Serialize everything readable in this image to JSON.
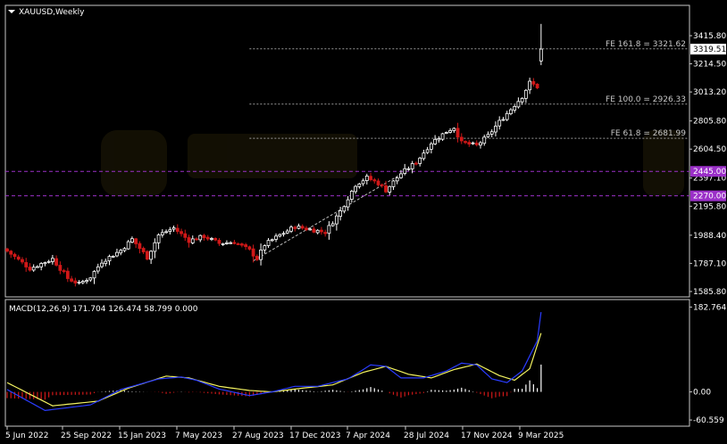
{
  "header": {
    "symbol_label": "XAUUSD,Weekly"
  },
  "indicator": {
    "label": "MACD(12,26,9) 171.704 126.474 58.799 0.000"
  },
  "colors": {
    "background": "#000000",
    "grid": "#3a3a3a",
    "frame": "#c8c8c8",
    "bull_candle": "#ffffff",
    "bear_candle": "#d01818",
    "fib_line": "#9a9a9a",
    "level_line": "#9b30c8",
    "level_badge": "#9b30c8",
    "current_price_badge": "#ffffff",
    "macd_line": "#2a3cff",
    "signal_line": "#f2f260",
    "hist_positive": "#ffffff",
    "hist_negative": "#d01818"
  },
  "chart_data": [
    {
      "type": "candlestick",
      "title": "XAUUSD,Weekly",
      "x_tick_labels": [
        "5 Jun 2022",
        "25 Sep 2022",
        "15 Jan 2023",
        "7 May 2023",
        "27 Aug 2023",
        "17 Dec 2023",
        "7 Apr 2024",
        "28 Jul 2024",
        "17 Nov 2024",
        "9 Mar 2025"
      ],
      "y_tick_labels": [
        "3415.80",
        "3214.50",
        "3013.20",
        "2805.80",
        "2604.50",
        "2397.10",
        "2195.80",
        "1988.40",
        "1787.10",
        "1585.80"
      ],
      "y_ticks": [
        3415.8,
        3214.5,
        3013.2,
        2805.8,
        2604.5,
        2397.1,
        2195.8,
        1988.4,
        1787.1,
        1585.8
      ],
      "ylim": [
        1560,
        3620
      ],
      "current_price": 3319.51,
      "current_price_label": "3319.51",
      "horizontal_levels": [
        {
          "value": 2445.0,
          "label": "2445.00"
        },
        {
          "value": 2270.0,
          "label": "2270.00"
        }
      ],
      "fib_levels": [
        {
          "value": 3321.62,
          "label": "FE 161.8 = 3321.62"
        },
        {
          "value": 2926.33,
          "label": "FE 100.0 = 2926.33"
        },
        {
          "value": 2681.99,
          "label": "FE 61.8 = 2681.99"
        }
      ],
      "trend_line": {
        "from_week": 65,
        "from_value": 1805,
        "to_week": 104,
        "to_value": 2425
      },
      "close_path": [
        [
          0,
          1875
        ],
        [
          6,
          1750
        ],
        [
          12,
          1820
        ],
        [
          16,
          1680
        ],
        [
          19,
          1640
        ],
        [
          22,
          1690
        ],
        [
          25,
          1800
        ],
        [
          30,
          1880
        ],
        [
          33,
          1960
        ],
        [
          37,
          1830
        ],
        [
          40,
          1990
        ],
        [
          44,
          2040
        ],
        [
          48,
          1950
        ],
        [
          52,
          1980
        ],
        [
          56,
          1930
        ],
        [
          60,
          1940
        ],
        [
          64,
          1880
        ],
        [
          66,
          1820
        ],
        [
          68,
          1920
        ],
        [
          72,
          1990
        ],
        [
          76,
          2050
        ],
        [
          80,
          2030
        ],
        [
          84,
          2010
        ],
        [
          88,
          2160
        ],
        [
          92,
          2350
        ],
        [
          95,
          2400
        ],
        [
          98,
          2360
        ],
        [
          100,
          2310
        ],
        [
          104,
          2430
        ],
        [
          108,
          2510
        ],
        [
          112,
          2650
        ],
        [
          116,
          2730
        ],
        [
          118,
          2760
        ],
        [
          120,
          2650
        ],
        [
          124,
          2630
        ],
        [
          127,
          2700
        ],
        [
          130,
          2800
        ],
        [
          134,
          2920
        ],
        [
          136,
          2980
        ],
        [
          138,
          3080
        ],
        [
          140,
          3050
        ],
        [
          141,
          3300
        ]
      ],
      "final_bar": {
        "open": 3235,
        "high": 3500,
        "low": 3205,
        "close": 3319.51
      }
    },
    {
      "type": "macd",
      "params": "MACD(12,26,9)",
      "values": {
        "macd": 171.704,
        "signal": 126.474,
        "histogram": 58.799,
        "zero": 0.0
      },
      "y_tick_labels": [
        "182.764",
        "0.00",
        "-60.559"
      ],
      "y_ticks": [
        182.764,
        0.0,
        -60.559
      ],
      "ylim": [
        -70,
        195
      ],
      "macd_path": [
        [
          0,
          5
        ],
        [
          10,
          -40
        ],
        [
          22,
          -28
        ],
        [
          30,
          5
        ],
        [
          40,
          28
        ],
        [
          46,
          32
        ],
        [
          50,
          25
        ],
        [
          56,
          6
        ],
        [
          64,
          -8
        ],
        [
          70,
          0
        ],
        [
          76,
          12
        ],
        [
          82,
          12
        ],
        [
          90,
          28
        ],
        [
          96,
          58
        ],
        [
          100,
          55
        ],
        [
          104,
          30
        ],
        [
          110,
          30
        ],
        [
          116,
          45
        ],
        [
          120,
          62
        ],
        [
          124,
          58
        ],
        [
          128,
          28
        ],
        [
          132,
          20
        ],
        [
          136,
          45
        ],
        [
          140,
          110
        ],
        [
          141,
          171.704
        ]
      ],
      "signal_path": [
        [
          0,
          20
        ],
        [
          12,
          -30
        ],
        [
          24,
          -20
        ],
        [
          32,
          8
        ],
        [
          42,
          34
        ],
        [
          48,
          30
        ],
        [
          56,
          12
        ],
        [
          64,
          3
        ],
        [
          70,
          0
        ],
        [
          78,
          8
        ],
        [
          86,
          15
        ],
        [
          94,
          42
        ],
        [
          100,
          55
        ],
        [
          106,
          38
        ],
        [
          112,
          30
        ],
        [
          118,
          48
        ],
        [
          124,
          60
        ],
        [
          130,
          35
        ],
        [
          134,
          25
        ],
        [
          138,
          50
        ],
        [
          141,
          126.474
        ]
      ]
    }
  ]
}
